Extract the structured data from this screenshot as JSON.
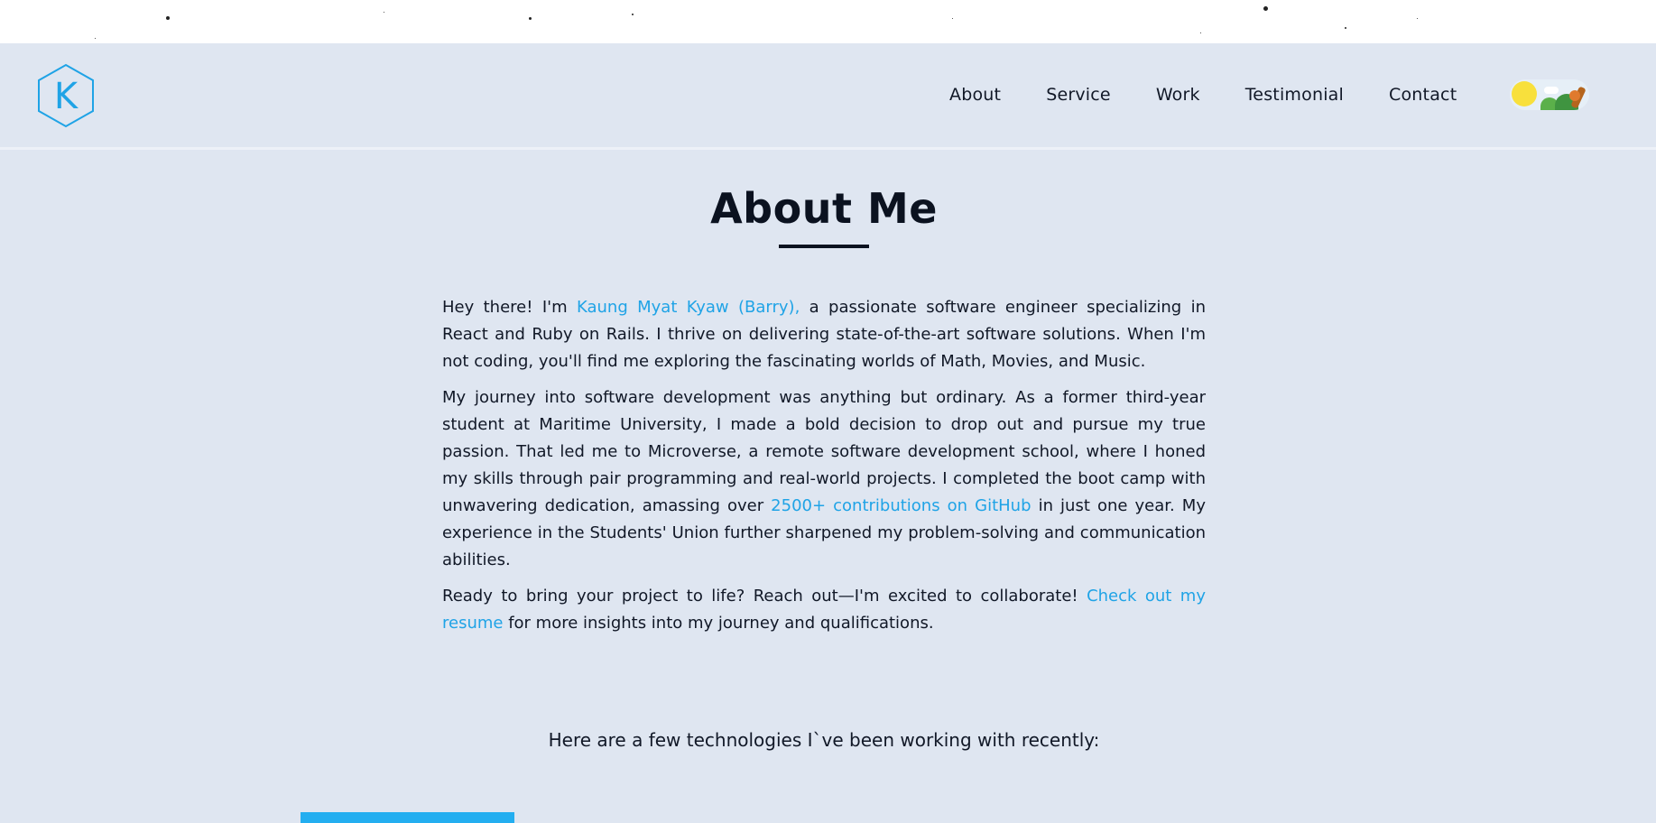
{
  "brand": {
    "logo_letter": "K",
    "accent_color": "#1fa3e6"
  },
  "nav": {
    "links": [
      "About",
      "Service",
      "Work",
      "Testimonial",
      "Contact"
    ]
  },
  "theme_toggle": {
    "mode": "light",
    "icon": "sun-toggle-icon"
  },
  "about": {
    "title": "About Me",
    "p1_before": "Hey there! I'm ",
    "p1_name": "Kaung Myat Kyaw (Barry),",
    "p1_after": " a passionate software engineer specializing in React and Ruby on Rails. I thrive on delivering state-of-the-art software solutions. When I'm not coding, you'll find me exploring the fascinating worlds of Math, Movies, and Music.",
    "p2_before": "My journey into software development was anything but ordinary. As a former third-year student at Maritime University, I made a bold decision to drop out and pursue my true passion. That led me to Microverse, a remote software development school, where I honed my skills through pair programming and real-world projects. I completed the boot camp with unwavering dedication, amassing over ",
    "p2_link": "2500+ contributions on GitHub",
    "p2_after": " in just one year. My experience in the Students' Union further sharpened my problem-solving and communication abilities.",
    "p3_before": "Ready to bring your project to life? Reach out—I'm excited to collaborate! ",
    "p3_link": "Check out my resume",
    "p3_after": " for more insights into my journey and qualifications."
  },
  "technologies": {
    "intro": "Here are a few technologies I`ve been working with recently:"
  }
}
